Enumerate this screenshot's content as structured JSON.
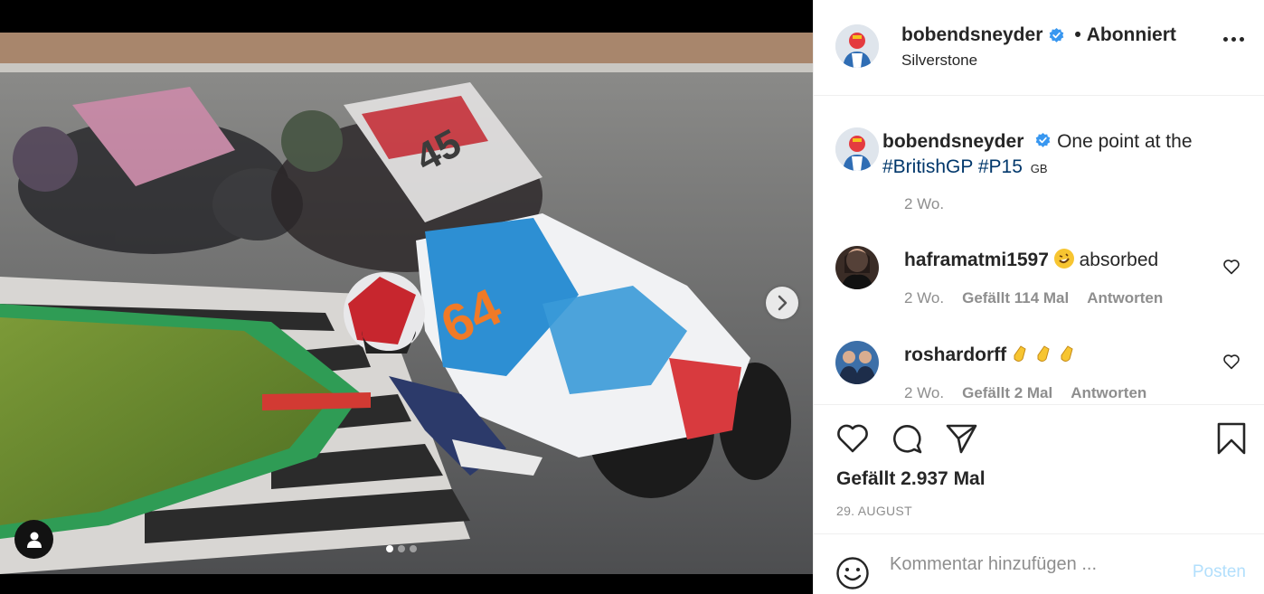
{
  "post": {
    "username": "bobendsneyder",
    "follow_status": "Abonniert",
    "location": "Silverstone",
    "caption": {
      "username": "bobendsneyder",
      "text": "One point at the",
      "hashtags": [
        "#BritishGP",
        "#P15"
      ],
      "flag": "GB",
      "time": "2 Wo."
    },
    "comments": [
      {
        "username": "haframatmi1597",
        "text": "absorbed",
        "emoji": "rolling-on-floor-laughing",
        "time": "2 Wo.",
        "likes": "Gefällt 114 Mal",
        "reply": "Antworten"
      },
      {
        "username": "roshardorff",
        "text": "",
        "emoji": "clapping-hands",
        "time": "2 Wo.",
        "likes": "Gefällt 2 Mal",
        "reply": "Antworten"
      }
    ],
    "likes_label": "Gefällt 2.937 Mal",
    "date": "29. AUGUST",
    "comment_placeholder": "Kommentar hinzufügen ...",
    "post_label": "Posten"
  },
  "media": {
    "slide_count": 3,
    "active_slide": 1,
    "rider_number": "64"
  },
  "colors": {
    "verified_blue": "#3897f0",
    "hashtag": "#00376b",
    "post_disabled": "#b2dffc",
    "secondary_text": "#8e8e8e"
  }
}
